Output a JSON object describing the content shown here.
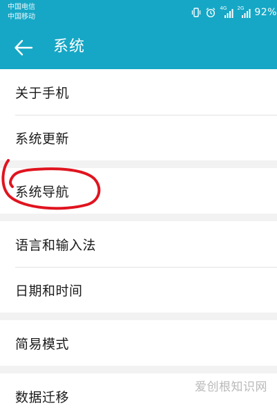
{
  "status_bar": {
    "carrier_1": "中国电信",
    "carrier_2": "中国移动",
    "icons": [
      "vibrate-icon",
      "alarm-icon",
      "signal-4g-icon",
      "signal-2g-icon"
    ],
    "signal_1_tag": "4G",
    "signal_2_tag": "2G",
    "battery": "92%"
  },
  "header": {
    "title": "系统",
    "back_icon": "arrow-left-icon",
    "color": "#16a7c6"
  },
  "groups": [
    {
      "items": [
        "关于手机",
        "系统更新"
      ]
    },
    {
      "items": [
        "系统导航"
      ],
      "annotated": true
    },
    {
      "items": [
        "语言和输入法",
        "日期和时间"
      ]
    },
    {
      "items": [
        "简易模式"
      ]
    },
    {
      "items": [
        "数据迁移"
      ]
    }
  ],
  "annotation_color": "#e0141f",
  "watermark": "爱创根知识网"
}
